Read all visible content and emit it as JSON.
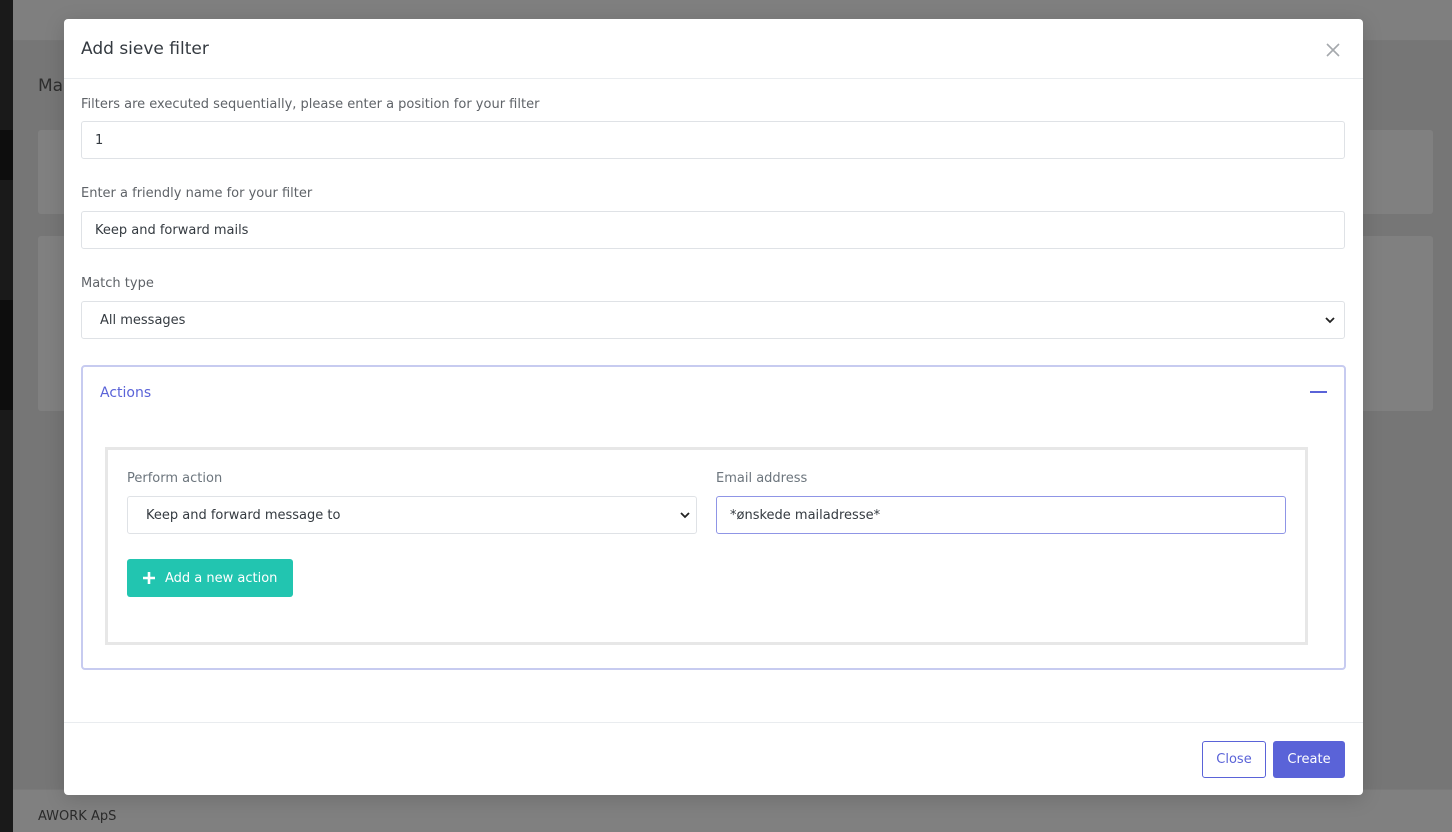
{
  "background": {
    "page_title_partial": "Ma",
    "footer_company": "AWORK ApS"
  },
  "modal": {
    "title": "Add sieve filter",
    "position_label": "Filters are executed sequentially, please enter a position for your filter",
    "position_value": "1",
    "name_label": "Enter a friendly name for your filter",
    "name_value": "Keep and forward mails",
    "match_type_label": "Match type",
    "match_type_value": "All messages",
    "actions": {
      "title": "Actions",
      "perform_action_label": "Perform action",
      "perform_action_value": "Keep and forward message to",
      "email_label": "Email address",
      "email_value": "*ønskede mailadresse*",
      "add_action_label": "Add a new action"
    },
    "footer": {
      "close_label": "Close",
      "create_label": "Create"
    }
  },
  "colors": {
    "primary": "#5a63d8",
    "teal": "#22c5b0",
    "overlay": "#808080"
  },
  "icons": {
    "close": "close-icon",
    "collapse": "minus-icon",
    "select": "chevron-down-icon",
    "add": "plus-icon"
  }
}
